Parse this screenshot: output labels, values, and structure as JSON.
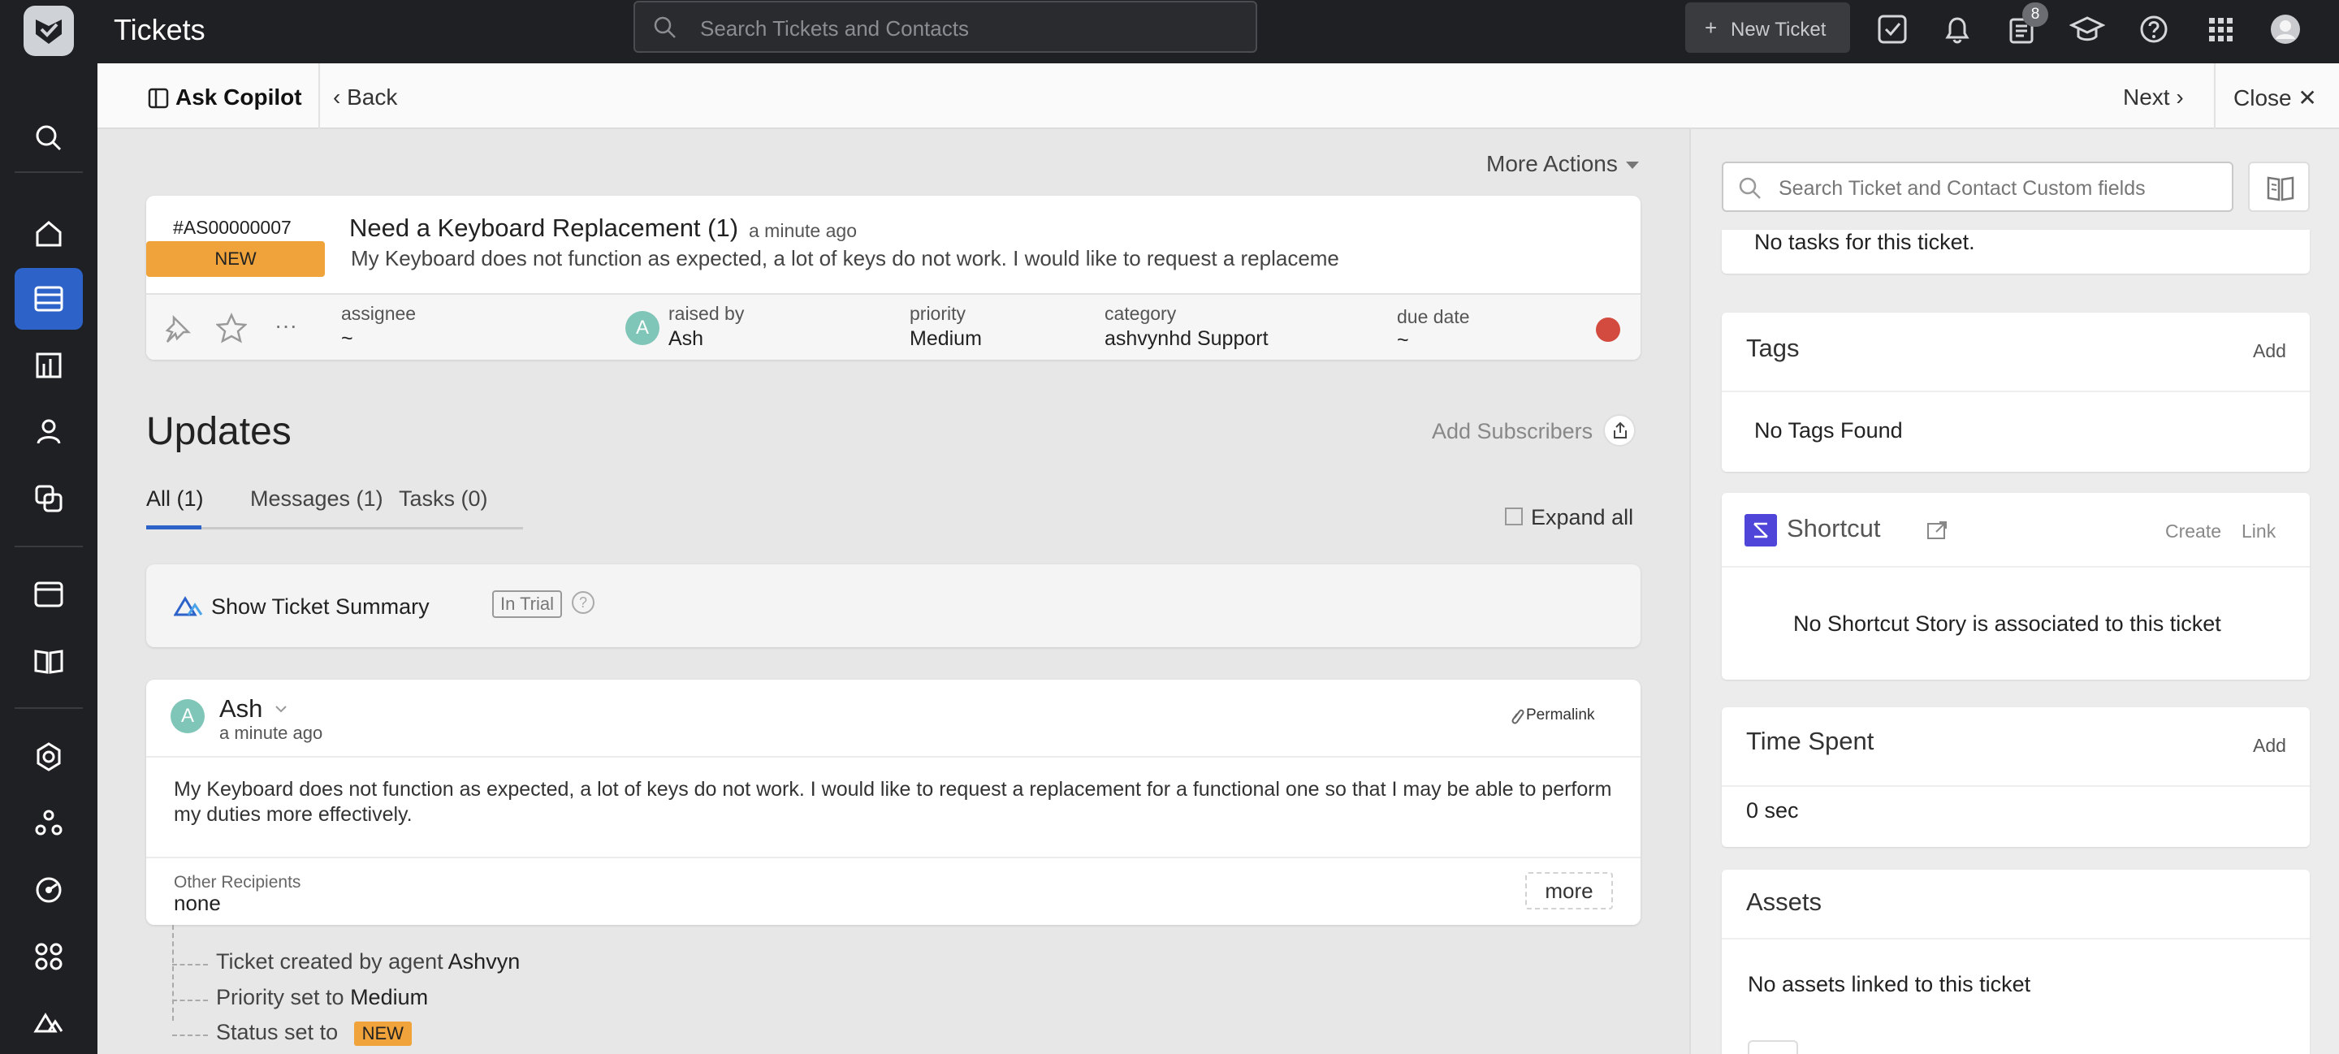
{
  "app": {
    "title": "Tickets"
  },
  "topbar": {
    "search_placeholder": "Search Tickets and Contacts",
    "new_ticket_label": "New Ticket",
    "notes_badge": "8"
  },
  "subheader": {
    "copilot_label": "Ask Copilot",
    "back_label": "Back",
    "next_label": "Next",
    "close_label": "Close"
  },
  "main": {
    "more_actions_label": "More Actions",
    "ticket": {
      "id": "#AS00000007",
      "status": "NEW",
      "title": "Need a Keyboard Replacement",
      "count": "(1)",
      "time": "a minute ago",
      "description": "My Keyboard does not function as expected, a lot of keys do not work. I would like to request a replaceme",
      "fields": {
        "assignee_label": "assignee",
        "assignee_value": "~",
        "raised_by_label": "raised by",
        "raised_by_value": "Ash",
        "raised_by_initial": "A",
        "priority_label": "priority",
        "priority_value": "Medium",
        "category_label": "category",
        "category_value": "ashvynhd Support",
        "due_date_label": "due date",
        "due_date_value": "~"
      }
    },
    "updates": {
      "title": "Updates",
      "add_subscribers_label": "Add Subscribers",
      "tabs": [
        {
          "label": "All (1)"
        },
        {
          "label": "Messages (1)"
        },
        {
          "label": "Tasks (0)"
        }
      ],
      "expand_all_label": "Expand all"
    },
    "summary": {
      "label": "Show Ticket Summary",
      "trial_badge": "In Trial",
      "help_glyph": "?"
    },
    "message": {
      "author": "Ash",
      "author_initial": "A",
      "time": "a minute ago",
      "permalink_label": "Permalink",
      "body": "My Keyboard does not function as expected, a lot of keys do not work. I would like to request a replacement for a functional one so that I may be able to perform my duties more effectively.",
      "other_recipients_label": "Other Recipients",
      "other_recipients_value": "none",
      "more_label": "more"
    },
    "activity": [
      {
        "prefix": "Ticket created by agent",
        "value": "Ashvyn"
      },
      {
        "prefix": "Priority set to",
        "value": "Medium"
      },
      {
        "prefix": "Status set to",
        "badge": "NEW"
      }
    ]
  },
  "right_panel": {
    "search_placeholder": "Search Ticket and Contact Custom fields",
    "tasks_empty": "No tasks for this ticket.",
    "tags": {
      "title": "Tags",
      "add_label": "Add",
      "empty": "No Tags Found"
    },
    "shortcut": {
      "title": "Shortcut",
      "create_label": "Create",
      "link_label": "Link",
      "empty": "No Shortcut Story is associated to this ticket"
    },
    "time_spent": {
      "title": "Time Spent",
      "add_label": "Add",
      "value": "0 sec"
    },
    "assets": {
      "title": "Assets",
      "empty": "No assets linked to this ticket",
      "add_glyph": "+"
    }
  },
  "colors": {
    "accent": "#2d62c9",
    "status_new": "#f0a33a",
    "topbar_bg": "#1f2023",
    "red_dot": "#d24b3e",
    "shortcut_brand": "#4f46d9"
  }
}
